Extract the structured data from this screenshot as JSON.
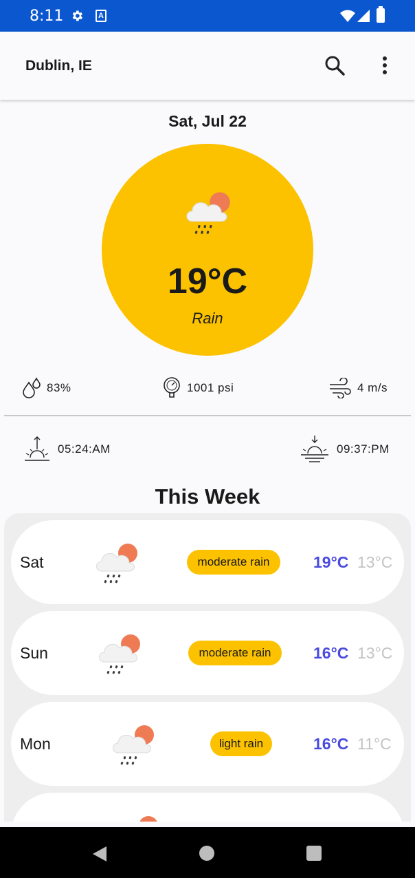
{
  "status_bar": {
    "time": "8:11",
    "accessibility_icon_letter": "A"
  },
  "app_bar": {
    "title": "Dublin, IE"
  },
  "current": {
    "date": "Sat, Jul 22",
    "temperature": "19°C",
    "condition": "Rain",
    "humidity": "83%",
    "pressure": "1001 psi",
    "wind": "4 m/s",
    "sunrise": "05:24:AM",
    "sunset": "09:37:PM"
  },
  "week": {
    "title": "This Week",
    "days": [
      {
        "day": "Sat",
        "desc": "moderate rain",
        "hi": "19°C",
        "lo": "13°C"
      },
      {
        "day": "Sun",
        "desc": "moderate rain",
        "hi": "16°C",
        "lo": "13°C"
      },
      {
        "day": "Mon",
        "desc": "light rain",
        "hi": "16°C",
        "lo": "11°C"
      }
    ]
  },
  "colors": {
    "status_bar": "#0b57d0",
    "accent_yellow": "#fcc200",
    "high_temp": "#4a4ae0",
    "low_temp": "#c4c4c4"
  },
  "icons": {
    "weather": "rain-cloud-sun-icon",
    "humidity": "droplets-icon",
    "pressure": "barometer-icon",
    "wind": "wind-icon",
    "sunrise": "sunrise-icon",
    "sunset": "sunset-icon"
  }
}
